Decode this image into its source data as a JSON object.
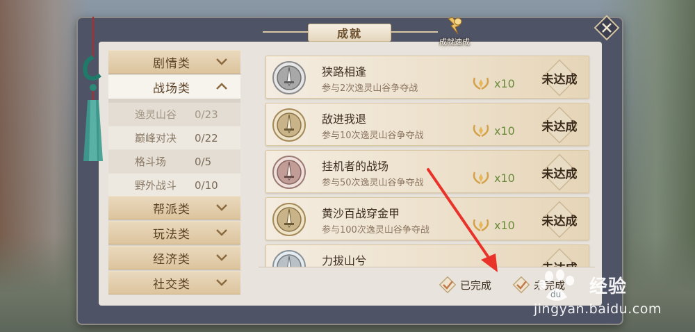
{
  "header": {
    "title": "成就",
    "speed_label": "成就速成"
  },
  "categories": [
    {
      "label": "剧情类",
      "state": "collapsed"
    },
    {
      "label": "战场类",
      "state": "expanded"
    },
    {
      "label": "帮派类",
      "state": "collapsed"
    },
    {
      "label": "玩法类",
      "state": "collapsed"
    },
    {
      "label": "经济类",
      "state": "collapsed"
    },
    {
      "label": "社交类",
      "state": "collapsed"
    }
  ],
  "subcategories": [
    {
      "name": "逸灵山谷",
      "count": "0/23",
      "selected": true
    },
    {
      "name": "巅峰对决",
      "count": "0/22",
      "selected": false
    },
    {
      "name": "格斗场",
      "count": "0/5",
      "selected": false
    },
    {
      "name": "野外战斗",
      "count": "0/10",
      "selected": false
    }
  ],
  "achievements": [
    {
      "name": "狭路相逢",
      "desc": "参与2次逸灵山谷争夺战",
      "reward_qty": "x10",
      "status": "未达成",
      "badge_tone": "#b9b9b9"
    },
    {
      "name": "敌进我退",
      "desc": "参与10次逸灵山谷争夺战",
      "reward_qty": "x10",
      "status": "未达成",
      "badge_tone": "#c9b489"
    },
    {
      "name": "挂机者的战场",
      "desc": "参与50次逸灵山谷争夺战",
      "reward_qty": "x10",
      "status": "未达成",
      "badge_tone": "#c29d97"
    },
    {
      "name": "黄沙百战穿金甲",
      "desc": "参与100次逸灵山谷争夺战",
      "reward_qty": "x10",
      "status": "未达成",
      "badge_tone": "#c9b489"
    },
    {
      "name": "力拔山兮",
      "desc": "",
      "reward_qty": "",
      "status": "未达成",
      "badge_tone": "#b9c0c6"
    }
  ],
  "filters": {
    "completed_label": "已完成",
    "incomplete_label": "未完成"
  },
  "watermark": {
    "brand": "经验",
    "url": "jingyan.baidu.com"
  },
  "colors": {
    "panel_frame": "#4e5366",
    "panel_inner": "#e8e3dc",
    "reward_green": "#6a8a3a",
    "annotation_red": "#e8322a"
  }
}
